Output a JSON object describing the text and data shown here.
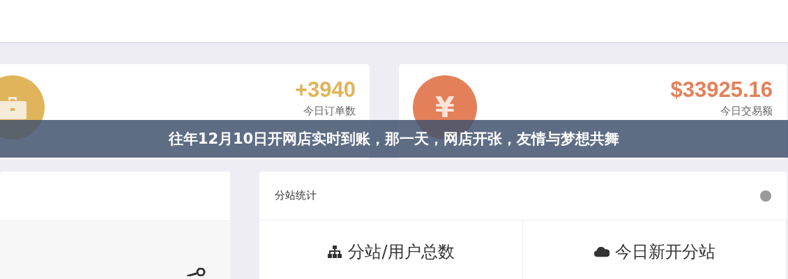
{
  "banner": {
    "title": "往年12月10日开网店实时到账，那一天，网店开张，友情与梦想共舞"
  },
  "stat_cards": [
    {
      "kind": "briefcase",
      "value": "+3940",
      "label": "今日订单数",
      "color": "#e0b45a"
    },
    {
      "kind": "yen",
      "glyph": "¥",
      "value": "$33925.16",
      "label": "今日交易额",
      "color": "#e3805a"
    }
  ],
  "site_stats": {
    "title": "分站统计",
    "cells": [
      {
        "kind": "sitemap",
        "label": "分站/用户总数"
      },
      {
        "kind": "cloud",
        "label": "今日新开分站"
      }
    ]
  }
}
